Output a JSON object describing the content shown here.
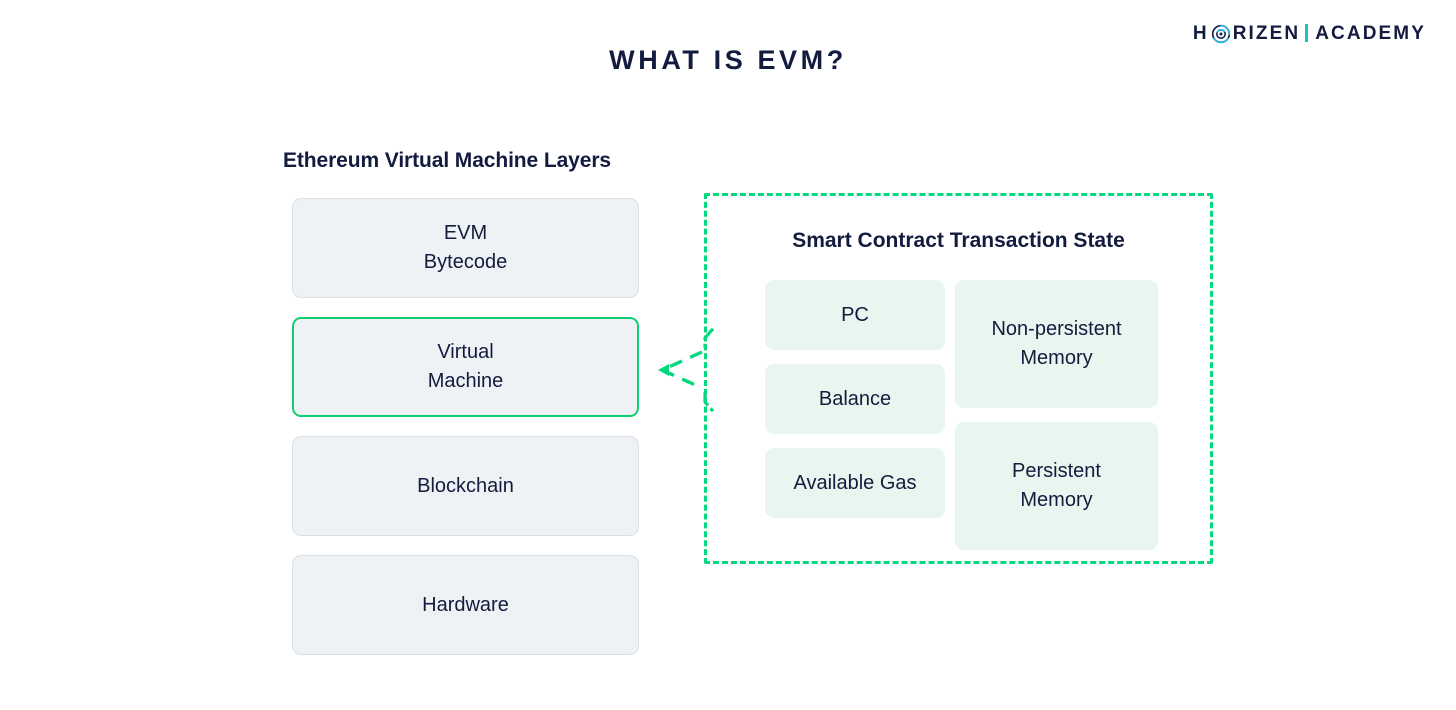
{
  "brand": {
    "name_primary": "H",
    "name_primary_rest": "RIZEN",
    "name_secondary": "ACADEMY",
    "logo_mark_icon": "horizen-circle-logo-icon",
    "divider_color": "#17c5c5"
  },
  "header": {
    "title": "WHAT IS EVM?"
  },
  "left_section": {
    "heading": "Ethereum Virtual Machine Layers",
    "layers": [
      {
        "label_line1": "EVM",
        "label_line2": "Bytecode",
        "highlighted": false
      },
      {
        "label_line1": "Virtual",
        "label_line2": "Machine",
        "highlighted": true
      },
      {
        "label_line1": "Blockchain",
        "label_line2": "",
        "highlighted": false
      },
      {
        "label_line1": "Hardware",
        "label_line2": "",
        "highlighted": false
      }
    ]
  },
  "connector": {
    "icon": "dashed-arrow-left-icon",
    "color": "#00d97e"
  },
  "right_section": {
    "title": "Smart Contract Transaction State",
    "border_style": "dashed",
    "border_color": "#00d97e",
    "left_column": [
      {
        "label": "PC"
      },
      {
        "label": "Balance"
      },
      {
        "label": "Available Gas"
      }
    ],
    "right_column": [
      {
        "label_line1": "Non-persistent",
        "label_line2": "Memory"
      },
      {
        "label_line1": "Persistent",
        "label_line2": "Memory"
      }
    ]
  },
  "colors": {
    "text_dark": "#131b3e",
    "accent_green": "#00d97e",
    "highlight_border": "#11cf70",
    "layer_fill": "#eff2f5",
    "layer_border": "#dbe0e8",
    "chip_fill": "#e9f6ef",
    "background": "#ffffff"
  }
}
